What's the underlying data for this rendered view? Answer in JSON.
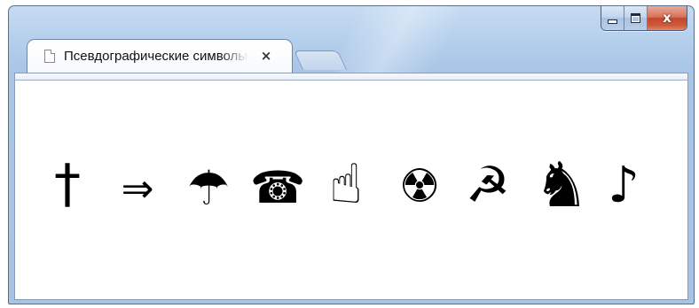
{
  "window": {
    "tab_title": "Псевдографические символы",
    "tab_close": "×",
    "controls": {
      "minimize_icon": "minimize-icon",
      "maximize_icon": "maximize-icon",
      "close_glyph": "x"
    }
  },
  "content": {
    "symbols": [
      {
        "name": "dagger",
        "char": "†"
      },
      {
        "name": "rightwards-double-arrow",
        "char": "⇒"
      },
      {
        "name": "umbrella",
        "char": "☂"
      },
      {
        "name": "telephone",
        "char": "☎"
      },
      {
        "name": "pointing-index",
        "char": "☝"
      },
      {
        "name": "radioactive",
        "char": "☢"
      },
      {
        "name": "hammer-and-sickle",
        "char": "☭"
      },
      {
        "name": "chess-knight",
        "char": "♞"
      },
      {
        "name": "eighth-note",
        "char": "♪"
      }
    ]
  },
  "colors": {
    "frame": "#b4cfec",
    "close_button": "#c4482c",
    "content_bg": "#ffffff"
  }
}
